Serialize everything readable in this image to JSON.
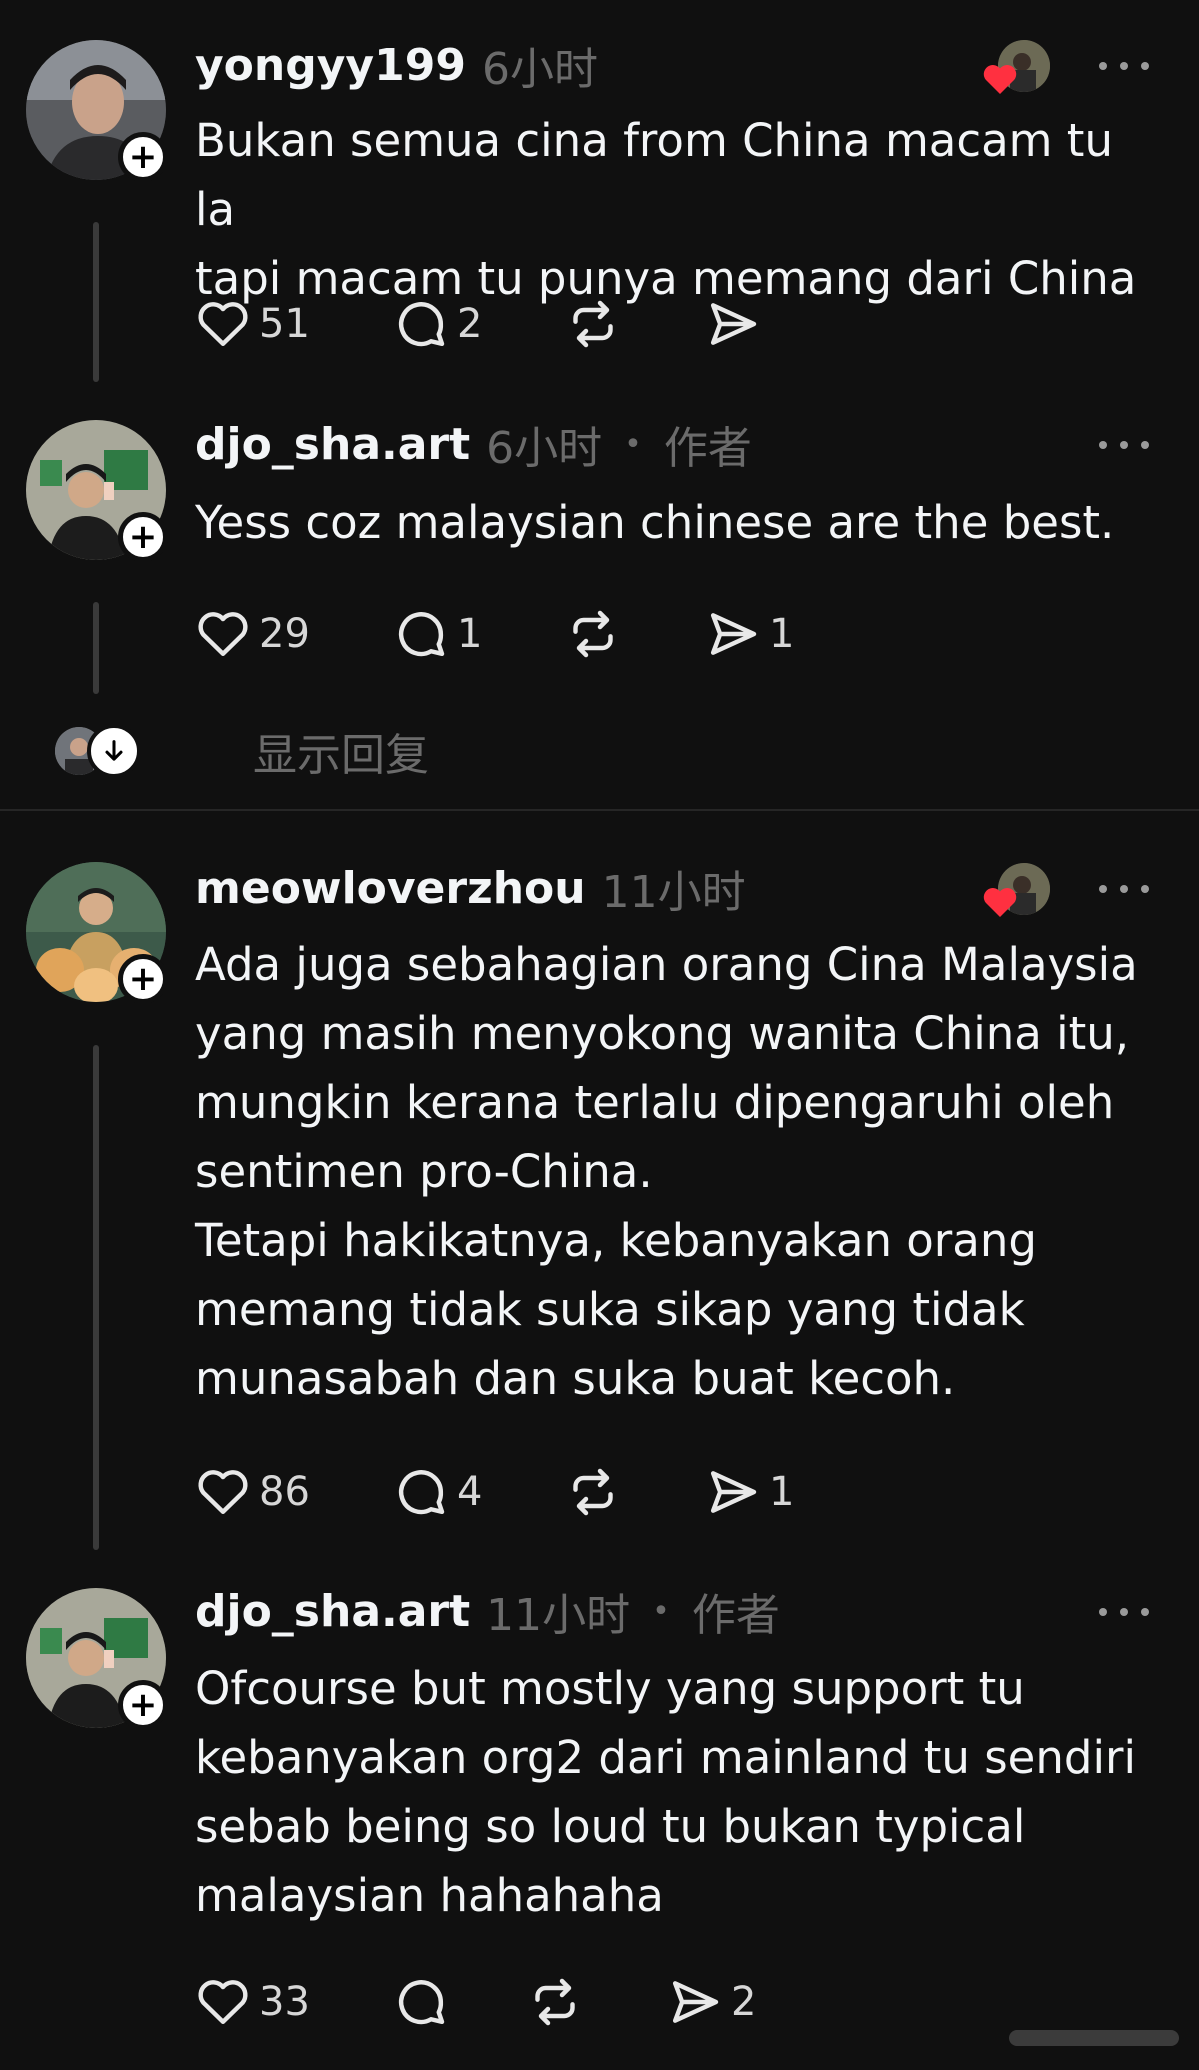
{
  "posts": [
    {
      "username": "yongyy199",
      "time": "6小时",
      "author_tag": "",
      "text": "Bukan semua cina from China macam tu la\ntapi macam tu punya memang dari China",
      "likes": "51",
      "replies": "2",
      "shares": ""
    },
    {
      "username": "djo_sha.art",
      "time": "6小时",
      "author_tag": "作者",
      "text": "Yess coz malaysian chinese are the best.",
      "likes": "29",
      "replies": "1",
      "shares": "1"
    },
    {
      "username": "meowloverzhou",
      "time": "11小时",
      "author_tag": "",
      "text": "Ada juga sebahagian orang Cina Malaysia\nyang masih menyokong wanita China itu,\nmungkin kerana terlalu dipengaruhi oleh\nsentimen pro-China.\nTetapi hakikatnya, kebanyakan orang\nmemang tidak suka sikap yang tidak\nmunasabah dan suka buat kecoh.",
      "likes": "86",
      "replies": "4",
      "shares": "1"
    },
    {
      "username": "djo_sha.art",
      "time": "11小时",
      "author_tag": "作者",
      "text": "Ofcourse but mostly yang support tu\nkebanyakan org2 dari mainland tu sendiri\nsebab being so loud tu bukan typical\nmalaysian hahahaha",
      "likes": "33",
      "replies": "",
      "shares": "2"
    }
  ],
  "show_replies_label": "显示回复",
  "icons": {
    "like": "heart-outline-icon",
    "reply": "comment-bubble-icon",
    "repost": "repost-icon",
    "share": "send-icon",
    "more": "more-dots-icon",
    "follow": "plus-icon",
    "expand": "arrow-down-icon"
  },
  "colors": {
    "background": "#101010",
    "text": "#f3f5f7",
    "muted": "#6b6b6b",
    "heart": "#ff3040"
  }
}
